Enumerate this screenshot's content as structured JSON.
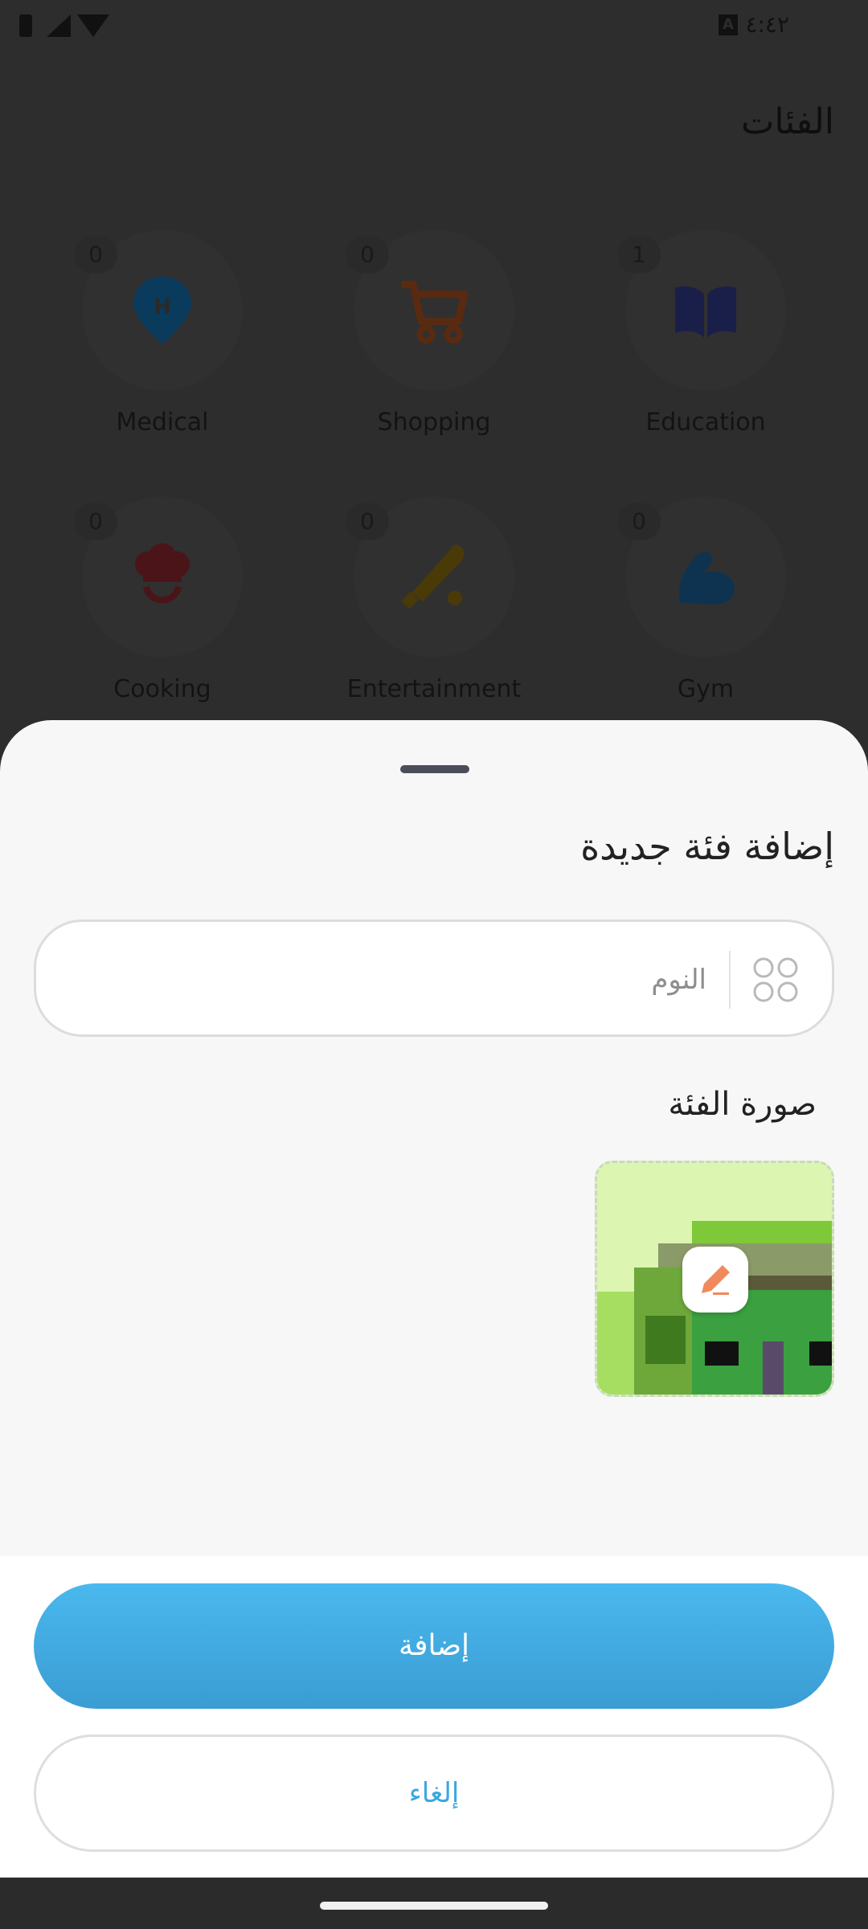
{
  "status_bar": {
    "time": "٤:٤٢",
    "badge": "A",
    "icons": [
      "battery-icon",
      "signal-icon",
      "wifi-icon"
    ]
  },
  "background_page": {
    "title": "الفئات",
    "categories": [
      {
        "label": "Medical",
        "count": "0",
        "icon": "hospital-pin-icon",
        "color": "#0a3a5c"
      },
      {
        "label": "Shopping",
        "count": "0",
        "icon": "shopping-cart-icon",
        "color": "#5a2a10"
      },
      {
        "label": "Education",
        "count": "1",
        "icon": "open-book-icon",
        "color": "#1a1f4a"
      },
      {
        "label": "Cooking",
        "count": "0",
        "icon": "chef-hat-icon",
        "color": "#4a1418"
      },
      {
        "label": "Entertainment",
        "count": "0",
        "icon": "baseball-bat-icon",
        "color": "#4a3a08"
      },
      {
        "label": "Gym",
        "count": "0",
        "icon": "flexed-arm-icon",
        "color": "#0e3350"
      }
    ]
  },
  "sheet": {
    "title": "إضافة فئة جديدة",
    "name_placeholder": "النوم",
    "name_value": "",
    "image_label": "صورة الفئة",
    "edit_icon": "pencil-icon",
    "accent": "#f08a5d"
  },
  "actions": {
    "add_label": "إضافة",
    "cancel_label": "إلغاء",
    "primary_color": "#42ace2"
  }
}
